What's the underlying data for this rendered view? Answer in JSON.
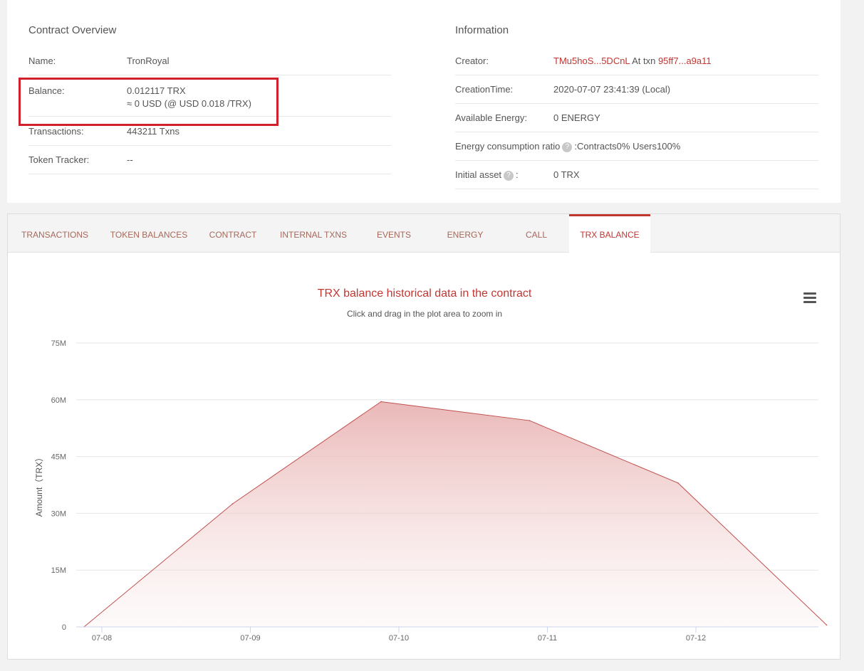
{
  "overview": {
    "title": "Contract Overview",
    "rows": [
      {
        "label": "Name:",
        "value": "TronRoyal"
      },
      {
        "label": "Balance:",
        "value": "0.012117 TRX",
        "value2": "≈ 0 USD (@ USD 0.018 /TRX)"
      },
      {
        "label": "Transactions:",
        "value": "443211  Txns"
      },
      {
        "label": "Token Tracker:",
        "value": "--"
      }
    ]
  },
  "information": {
    "title": "Information",
    "creator_label": "Creator:",
    "creator_address": "TMu5hoS...5DCnL",
    "creator_at": " At txn ",
    "creator_txn": "95ff7...a9a11",
    "creation_time_label": "CreationTime:",
    "creation_time": "2020-07-07 23:41:39 (Local)",
    "energy_label": "Available Energy:",
    "energy_value": "0  ENERGY",
    "ratio_label": "Energy consumption ratio",
    "ratio_value": ":Contracts0%  Users100%",
    "initial_label": "Initial asset",
    "initial_colon": ":",
    "initial_value": "0 TRX",
    "qmark": "?"
  },
  "tabs": [
    {
      "label": "TRANSACTIONS",
      "active": false
    },
    {
      "label": "TOKEN BALANCES",
      "active": false
    },
    {
      "label": "CONTRACT",
      "active": false
    },
    {
      "label": "INTERNAL TXNS",
      "active": false
    },
    {
      "label": "EVENTS",
      "active": false
    },
    {
      "label": "ENERGY",
      "active": false
    },
    {
      "label": "CALL",
      "active": false
    },
    {
      "label": "TRX BALANCE",
      "active": true
    }
  ],
  "colors": {
    "accent": "#c23631",
    "highlight_box": "#d0202b",
    "area_fill": "#e9b4b4"
  },
  "chart_data": {
    "type": "area",
    "title": "TRX balance historical data in the contract",
    "subtitle": "Click and drag in the plot area to zoom in",
    "ylabel": "Amount（TRX）",
    "xlabel": "",
    "x_ticks": [
      "07-08",
      "07-09",
      "07-10",
      "07-11",
      "07-12"
    ],
    "y_ticks": [
      "0",
      "15M",
      "30M",
      "45M",
      "60M",
      "75M"
    ],
    "ylim": [
      0,
      75000000
    ],
    "grid": true,
    "series": [
      {
        "x": [
          -0.12,
          0.88,
          1.88,
          2.88,
          3.88,
          4.88
        ],
        "values": [
          0,
          32500000,
          59500000,
          54500000,
          38000000,
          500000
        ]
      }
    ]
  }
}
